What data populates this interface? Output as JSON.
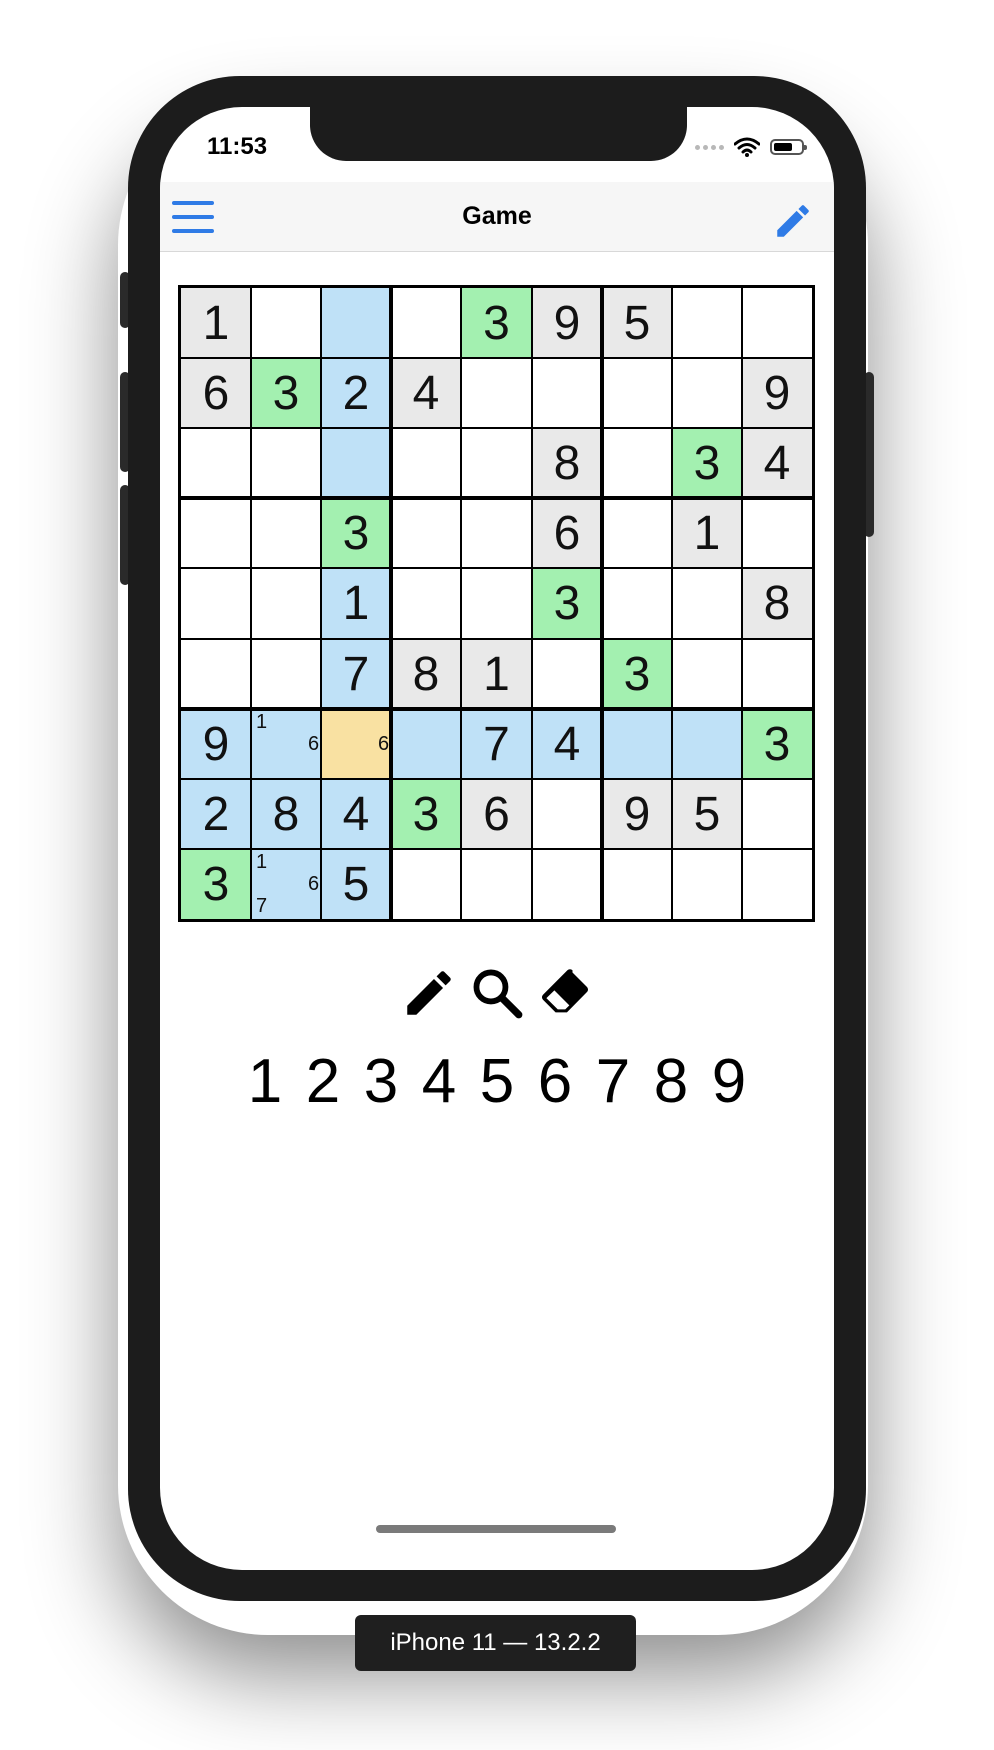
{
  "status": {
    "time": "11:53"
  },
  "nav": {
    "title": "Game"
  },
  "colors": {
    "given": "#e9e9e9",
    "highlight": "#bfe1f7",
    "match": "#a3f0b0",
    "selected": "#f9e1a2",
    "empty": "#ffffff",
    "accent": "#2f7be6"
  },
  "grid": [
    [
      "1",
      "",
      "",
      "",
      "3",
      "9",
      "5",
      "",
      ""
    ],
    [
      "6",
      "3",
      "2",
      "4",
      "",
      "",
      "",
      "",
      "9"
    ],
    [
      "",
      "",
      "",
      "",
      "",
      "8",
      "",
      "3",
      "4"
    ],
    [
      "",
      "",
      "3",
      "",
      "",
      "6",
      "",
      "1",
      ""
    ],
    [
      "",
      "",
      "1",
      "",
      "",
      "3",
      "",
      "",
      "8"
    ],
    [
      "",
      "",
      "7",
      "8",
      "1",
      "",
      "3",
      "",
      ""
    ],
    [
      "9",
      "",
      "",
      "",
      "7",
      "4",
      "",
      "",
      "3"
    ],
    [
      "2",
      "8",
      "4",
      "3",
      "6",
      "",
      "9",
      "5",
      ""
    ],
    [
      "3",
      "",
      "5",
      "",
      "",
      "",
      "",
      "",
      ""
    ]
  ],
  "cell_states": [
    [
      "g",
      "e",
      "h",
      "e",
      "m",
      "g",
      "g",
      "e",
      "e"
    ],
    [
      "g",
      "m",
      "h",
      "g",
      "e",
      "e",
      "e",
      "e",
      "g"
    ],
    [
      "e",
      "e",
      "h",
      "e",
      "e",
      "g",
      "e",
      "m",
      "g"
    ],
    [
      "e",
      "e",
      "m",
      "e",
      "e",
      "g",
      "e",
      "g",
      "e"
    ],
    [
      "e",
      "e",
      "h",
      "e",
      "e",
      "m",
      "e",
      "e",
      "g"
    ],
    [
      "e",
      "e",
      "h",
      "g",
      "g",
      "e",
      "m",
      "e",
      "e"
    ],
    [
      "h",
      "h",
      "s",
      "h",
      "h",
      "h",
      "h",
      "h",
      "m"
    ],
    [
      "h",
      "h",
      "h",
      "m",
      "g",
      "e",
      "g",
      "g",
      "e"
    ],
    [
      "m",
      "h",
      "h",
      "e",
      "e",
      "e",
      "e",
      "e",
      "e"
    ]
  ],
  "notes": [
    {
      "row": 6,
      "col": 1,
      "digits": [
        "1",
        "6"
      ]
    },
    {
      "row": 6,
      "col": 2,
      "digits": [
        "6"
      ]
    },
    {
      "row": 8,
      "col": 1,
      "digits": [
        "1",
        "6",
        "7"
      ]
    }
  ],
  "tools": [
    {
      "icon": "pencil-icon"
    },
    {
      "icon": "magnifier-icon"
    },
    {
      "icon": "eraser-icon"
    }
  ],
  "number_pad": [
    "1",
    "2",
    "3",
    "4",
    "5",
    "6",
    "7",
    "8",
    "9"
  ],
  "caption": "iPhone 11 — 13.2.2"
}
